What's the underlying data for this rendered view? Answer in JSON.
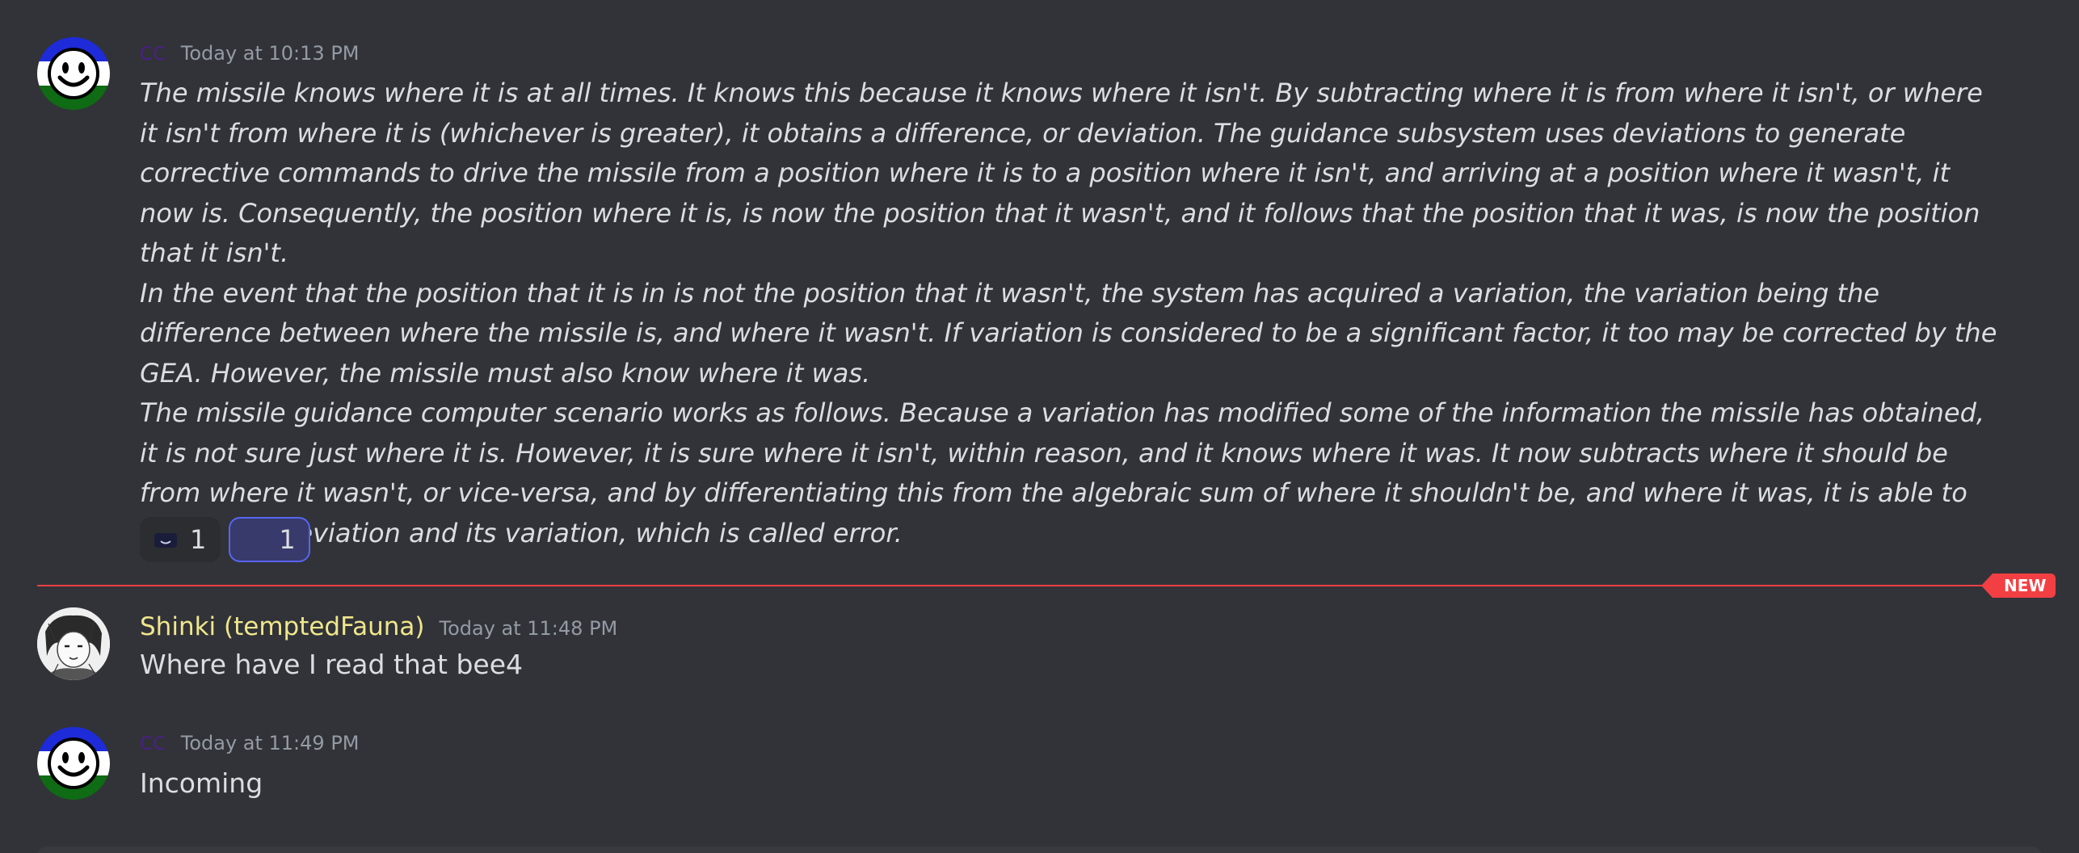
{
  "messages": [
    {
      "author": "CC",
      "timestamp": "Today at 10:13 PM",
      "paragraphs": [
        "The missile knows where it is at all times. It knows this because it knows where it isn't. By subtracting where it is from where it isn't, or where it isn't from where it is (whichever is greater), it obtains a difference, or deviation. The guidance subsystem uses deviations to generate corrective commands to drive the missile from a position where it is to a position where it isn't, and arriving at a position where it wasn't, it now is. Consequently, the position where it is, is now the position that it wasn't, and it follows that the position that it was, is now the position that it isn't.",
        "In the event that the position that it is in is not the position that it wasn't, the system has acquired a variation, the variation being the difference between where the missile is, and where it wasn't. If variation is considered to be a significant factor, it too may be corrected by the GEA. However, the missile must also know where it was.",
        "The missile guidance computer scenario works as follows. Because a variation has modified some of the information the missile has obtained, it is not sure just where it is. However, it is sure where it isn't, within reason, and it knows where it was. It now subtracts where it should be from where it wasn't, or vice-versa, and by differentiating this from the algebraic sum of where it shouldn't be, and where it was, it is able to obtain the deviation and its variation, which is called error."
      ],
      "reactions": [
        {
          "emoji": "smiling-face-emoji",
          "count": "1",
          "active": false
        },
        {
          "emoji": "crescent-moon-emoji",
          "count": "1",
          "active": true
        }
      ]
    },
    {
      "author": "Shinki (temptedFauna)",
      "timestamp": "Today at 11:48 PM",
      "text": "Where have I read that bee4"
    },
    {
      "author": "CC",
      "timestamp": "Today at 11:49 PM",
      "text": "Incoming"
    }
  ],
  "divider": {
    "label": "NEW"
  },
  "colors": {
    "background": "#313338",
    "cc_name": "#4b1f8a",
    "shinki_name": "#f0e68c",
    "new_divider": "#f23f43",
    "reaction_active_border": "#5865f2"
  }
}
